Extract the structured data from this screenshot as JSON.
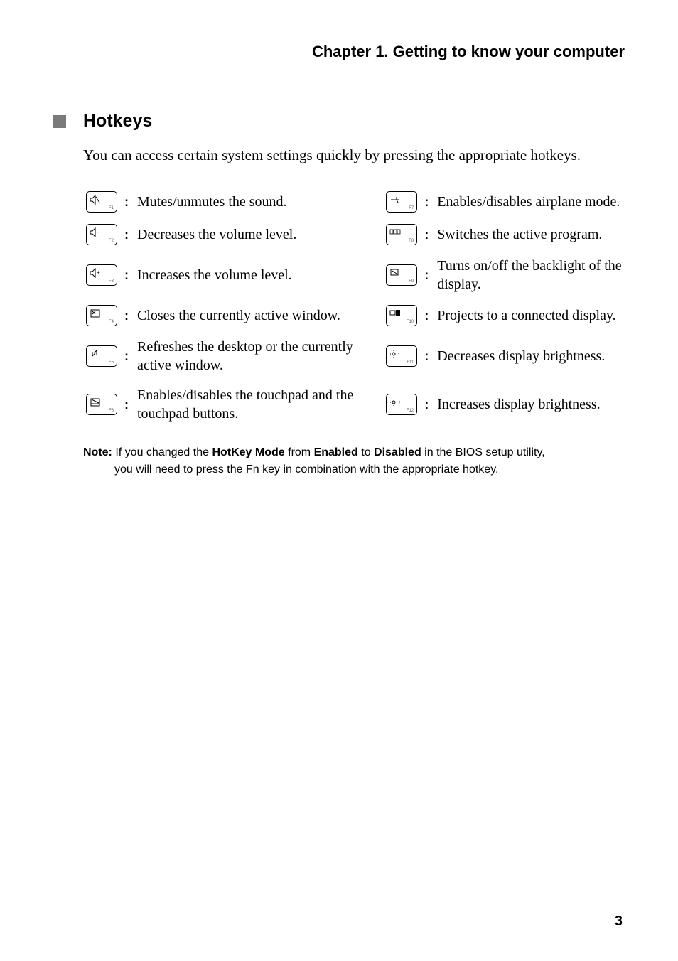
{
  "chapter_title": "Chapter 1. Getting to know your computer",
  "section_title": "Hotkeys",
  "intro": "You can access certain system settings quickly by pressing the appropriate hotkeys.",
  "rows": [
    {
      "left_fn": "F1",
      "left_desc": "Mutes/unmutes the sound.",
      "right_fn": "F7",
      "right_desc": "Enables/disables airplane mode."
    },
    {
      "left_fn": "F2",
      "left_desc": "Decreases the volume level.",
      "right_fn": "F8",
      "right_desc": "Switches the active program."
    },
    {
      "left_fn": "F3",
      "left_desc": "Increases the volume level.",
      "right_fn": "F9",
      "right_desc": "Turns on/off the backlight of the display."
    },
    {
      "left_fn": "F4",
      "left_desc": "Closes the currently active window.",
      "right_fn": "F10",
      "right_desc": "Projects to a connected display."
    },
    {
      "left_fn": "F5",
      "left_desc": "Refreshes the desktop or the currently active window.",
      "right_fn": "F11",
      "right_desc": "Decreases display brightness."
    },
    {
      "left_fn": "F6",
      "left_desc": "Enables/disables the touchpad and the touchpad buttons.",
      "right_fn": "F12",
      "right_desc": "Increases display brightness."
    }
  ],
  "note_label": "Note:",
  "note_line1_before": " If you changed the ",
  "note_bold1": "HotKey Mode",
  "note_mid1": " from ",
  "note_bold2": "Enabled",
  "note_mid2": " to ",
  "note_bold3": "Disabled",
  "note_after": " in the BIOS setup utility,",
  "note_line2": "you will need to press the Fn key in combination with the appropriate hotkey.",
  "page_number": "3"
}
